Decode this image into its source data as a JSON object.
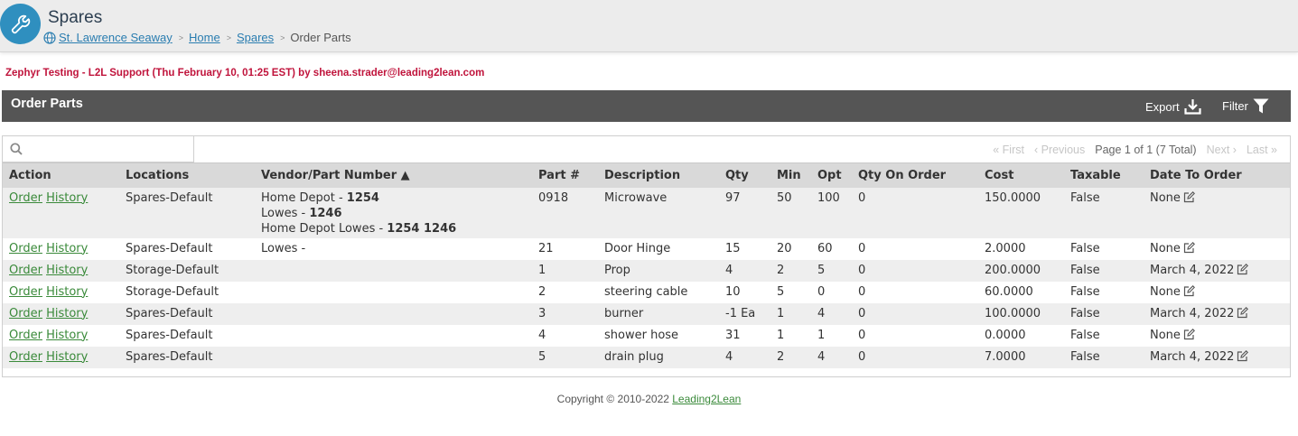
{
  "app": {
    "title": "Spares",
    "breadcrumb": [
      "St. Lawrence Seaway",
      "Home",
      "Spares",
      "Order Parts"
    ],
    "breadcrumb_sep": ">"
  },
  "session_text": "Zephyr Testing - L2L Support (Thu February 10, 01:25 EST) by sheena.strader@leading2lean.com",
  "panel": {
    "title": "Order Parts",
    "export_label": "Export",
    "filter_label": "Filter"
  },
  "search": {
    "placeholder": "",
    "value": ""
  },
  "pager": {
    "first": "« First",
    "previous": "‹ Previous",
    "info": "Page 1 of 1 (7 Total)",
    "next": "Next ›",
    "last": "Last »"
  },
  "columns": [
    "Action",
    "Locations",
    "Vendor/Part Number ▲",
    "Part #",
    "Description",
    "Qty",
    "Min",
    "Opt",
    "Qty On Order",
    "Cost",
    "Taxable",
    "Date To Order"
  ],
  "action_labels": {
    "order": "Order",
    "history": "History"
  },
  "rows": [
    {
      "location": "Spares-Default",
      "vendors": [
        {
          "name": "Home Depot - ",
          "number": "1254"
        },
        {
          "name": "Lowes - ",
          "number": "1246"
        },
        {
          "name": "Home Depot Lowes - ",
          "number": "1254 1246"
        }
      ],
      "part": "0918",
      "description": "Microwave",
      "qty": "97",
      "min": "50",
      "opt": "100",
      "on_order": "0",
      "cost": "150.0000",
      "taxable": "False",
      "date": "None"
    },
    {
      "location": "Spares-Default",
      "vendors": [
        {
          "name": "Lowes - ",
          "number": ""
        }
      ],
      "part": "21",
      "description": "Door Hinge",
      "qty": "15",
      "min": "20",
      "opt": "60",
      "on_order": "0",
      "cost": "2.0000",
      "taxable": "False",
      "date": "None"
    },
    {
      "location": "Storage-Default",
      "vendors": [],
      "part": "1",
      "description": "Prop",
      "qty": "4",
      "min": "2",
      "opt": "5",
      "on_order": "0",
      "cost": "200.0000",
      "taxable": "False",
      "date": "March 4, 2022"
    },
    {
      "location": "Storage-Default",
      "vendors": [],
      "part": "2",
      "description": "steering cable",
      "qty": "10",
      "min": "5",
      "opt": "0",
      "on_order": "0",
      "cost": "60.0000",
      "taxable": "False",
      "date": "None"
    },
    {
      "location": "Spares-Default",
      "vendors": [],
      "part": "3",
      "description": "burner",
      "qty": "-1 Ea",
      "min": "1",
      "opt": "4",
      "on_order": "0",
      "cost": "100.0000",
      "taxable": "False",
      "date": "March 4, 2022"
    },
    {
      "location": "Spares-Default",
      "vendors": [],
      "part": "4",
      "description": "shower hose",
      "qty": "31",
      "min": "1",
      "opt": "1",
      "on_order": "0",
      "cost": "0.0000",
      "taxable": "False",
      "date": "None"
    },
    {
      "location": "Spares-Default",
      "vendors": [],
      "part": "5",
      "description": "drain plug",
      "qty": "4",
      "min": "2",
      "opt": "4",
      "on_order": "0",
      "cost": "7.0000",
      "taxable": "False",
      "date": "March 4, 2022"
    }
  ],
  "footer": {
    "copyright": "Copyright © 2010-2022 ",
    "company_link": "Leading2Lean"
  },
  "colors": {
    "brand_blue": "#2f8fbf",
    "panel_bar": "#555555",
    "session_text": "#c0143c",
    "link_green": "#3a8a3a"
  },
  "icons": [
    "wrench-icon",
    "globe-icon",
    "export-icon",
    "filter-icon",
    "search-icon",
    "edit-icon"
  ]
}
